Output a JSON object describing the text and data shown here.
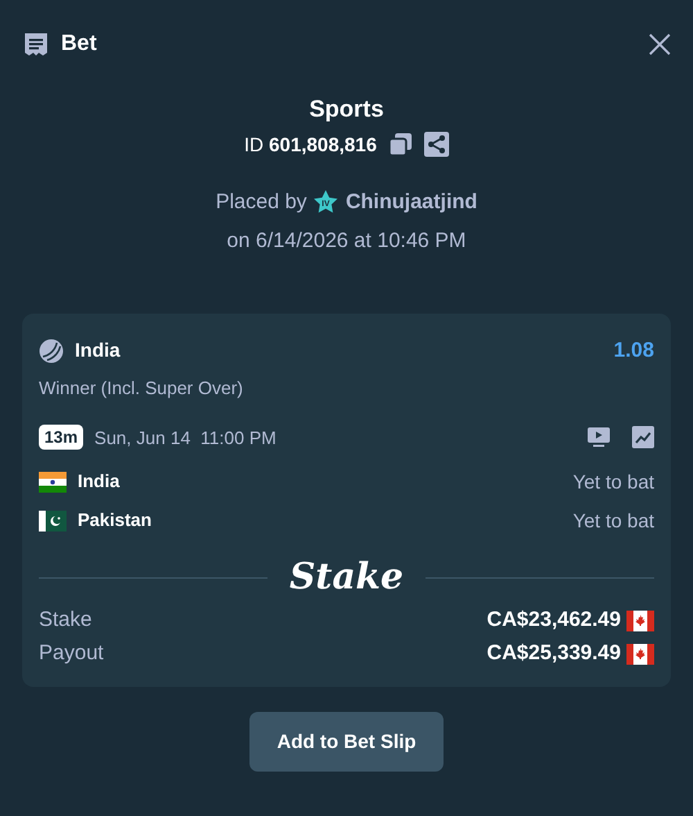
{
  "header": {
    "title": "Bet"
  },
  "summary": {
    "category": "Sports",
    "id_label": "ID",
    "id_value": "601,808,816",
    "placed_by_label": "Placed by",
    "vip_badge": "IV",
    "username": "Chinujaatjind",
    "placed_on": "on 6/14/2026 at 10:46 PM"
  },
  "selection": {
    "pick": "India",
    "odds": "1.08",
    "market": "Winner (Incl. Super Over)",
    "countdown": "13m",
    "start_time": "Sun, Jun 14  11:00 PM",
    "teams": [
      {
        "name": "India",
        "kind": "india",
        "status": "Yet to bat"
      },
      {
        "name": "Pakistan",
        "kind": "pakistan",
        "status": "Yet to bat"
      }
    ]
  },
  "brand": "Stake",
  "totals": [
    {
      "label": "Stake",
      "amount": "CA$23,462.49"
    },
    {
      "label": "Payout",
      "amount": "CA$25,339.49"
    }
  ],
  "button": "Add to Bet Slip"
}
